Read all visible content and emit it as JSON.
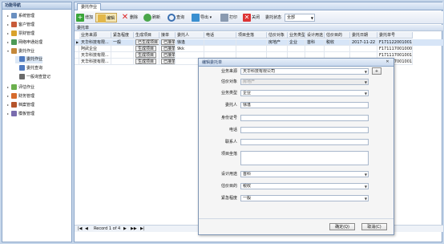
{
  "sidebar": {
    "title": "功能导航",
    "items": [
      {
        "label": "系统管理",
        "color": "#6a8fc0",
        "tri": "▸"
      },
      {
        "label": "客户管理",
        "color": "#c85b3a",
        "tri": "▸"
      },
      {
        "label": "票财管理",
        "color": "#d9a22c",
        "tri": "▸"
      },
      {
        "label": "网络申通处理",
        "color": "#4c9a55",
        "tri": "▸"
      },
      {
        "label": "委托作业",
        "color": "#c4883a",
        "tri": "▾"
      },
      {
        "label": "委托作业",
        "color": "#4f7ac0",
        "tri": ""
      },
      {
        "label": "委托查询",
        "color": "#4f7ac0",
        "tri": ""
      },
      {
        "label": "一般询查登记",
        "color": "#6b6b6b",
        "tri": ""
      },
      {
        "label": "评估作业",
        "color": "#6bb04d",
        "tri": "▸"
      },
      {
        "label": "财务管理",
        "color": "#d66a2c",
        "tri": "▸"
      },
      {
        "label": "档案管理",
        "color": "#b5542b",
        "tri": "▸"
      },
      {
        "label": "模板管理",
        "color": "#7a6cae",
        "tri": "▸"
      }
    ]
  },
  "tab": {
    "label": "委托作业"
  },
  "toolbar": {
    "add": "增加",
    "edit": "编辑",
    "delete": "删除",
    "refresh": "刷新",
    "query": "查询",
    "export": "导出 ▾",
    "print": "打印",
    "close": "关闭",
    "status_label": "委托状态",
    "status_value": "全部"
  },
  "section": {
    "title": "委托单"
  },
  "grid": {
    "columns": [
      "业务来源",
      "紧急程度",
      "生成项目",
      "接单",
      "委托人",
      "电话",
      "项目坐落",
      "估价对象",
      "业务类型",
      "设计用途",
      "估价目的",
      "委托日期",
      "委托单号"
    ],
    "rows": [
      [
        "天华科技有限...",
        "一般",
        "已生成项目",
        "已接单",
        "徐逢",
        "",
        "",
        "房地产",
        "企业",
        "首科",
        "税收",
        "2017-11-22",
        "F1711220010019"
      ],
      [
        "阿武企业",
        "",
        "生成项目",
        "已接单",
        "9kk",
        "",
        "",
        "",
        "",
        "",
        "",
        "",
        "F1711170010004"
      ],
      [
        "天华科技有限...",
        "",
        "生成项目",
        "已接单",
        "",
        "",
        "",
        "",
        "",
        "",
        "",
        "",
        "F1711170010018"
      ],
      [
        "天华科技有限...",
        "",
        "生成项目",
        "已接单",
        "",
        "",
        "",
        "",
        "",
        "",
        "",
        "",
        "F1711170010019"
      ]
    ]
  },
  "pager": {
    "first": "|◀",
    "prev": "◀",
    "record": "Record 1 of 4",
    "next": "▶",
    "next_page": "▶▶",
    "last": "▶|"
  },
  "dialog": {
    "title": "编辑委托单",
    "close": "✕",
    "fields": {
      "source": {
        "label": "业务来源",
        "value": "天华科技有限公司"
      },
      "object": {
        "label": "估价对象",
        "value": "房地产"
      },
      "type": {
        "label": "业务类型",
        "value": "企业"
      },
      "client": {
        "label": "委托人",
        "value": "徐逢"
      },
      "idno": {
        "label": "身份证号",
        "value": ""
      },
      "phone": {
        "label": "电话",
        "value": ""
      },
      "contact": {
        "label": "联系人",
        "value": ""
      },
      "location": {
        "label": "项目坐落",
        "value": ""
      },
      "usage": {
        "label": "设计用途",
        "value": "首科"
      },
      "purpose": {
        "label": "估价目的",
        "value": "税收"
      },
      "urgency": {
        "label": "紧急程度",
        "value": "一般"
      }
    },
    "add_btn": "+",
    "ok": "确定(Q)",
    "cancel": "取消(C)"
  }
}
